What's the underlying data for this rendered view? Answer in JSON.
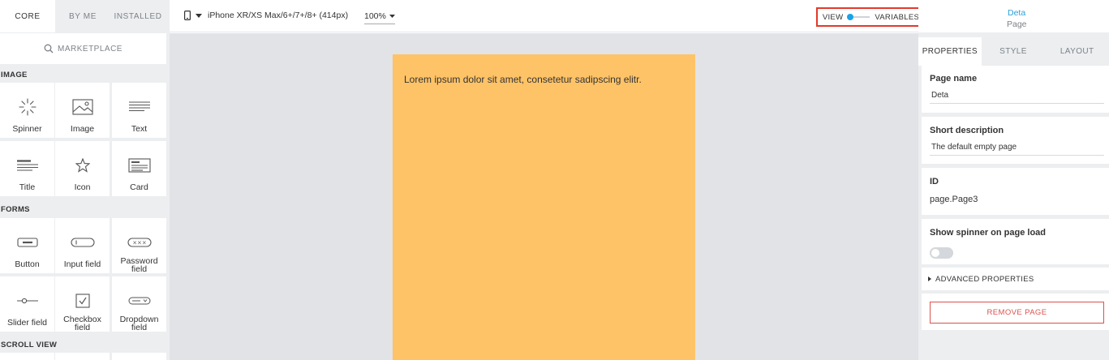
{
  "left_panel": {
    "tabs": [
      {
        "label": "CORE",
        "active": true
      },
      {
        "label": "BY ME",
        "active": false
      },
      {
        "label": "INSTALLED",
        "active": false
      }
    ],
    "marketplace_label": "MARKETPLACE",
    "sections": {
      "image": {
        "title": "IMAGE",
        "tiles": [
          {
            "label": "Spinner",
            "icon": "spinner-icon"
          },
          {
            "label": "Image",
            "icon": "image-icon"
          },
          {
            "label": "Text",
            "icon": "text-icon"
          },
          {
            "label": "Title",
            "icon": "title-icon"
          },
          {
            "label": "Icon",
            "icon": "star-icon"
          },
          {
            "label": "Card",
            "icon": "card-icon"
          }
        ]
      },
      "forms": {
        "title": "FORMS",
        "tiles": [
          {
            "label": "Button",
            "icon": "button-icon"
          },
          {
            "label": "Input field",
            "icon": "input-field-icon"
          },
          {
            "label": "Password field",
            "icon": "password-field-icon"
          },
          {
            "label": "Slider field",
            "icon": "slider-icon"
          },
          {
            "label": "Checkbox field",
            "icon": "checkbox-icon"
          },
          {
            "label": "Dropdown field",
            "icon": "dropdown-icon"
          }
        ]
      },
      "scroll_view": {
        "title": "SCROLL VIEW"
      }
    }
  },
  "toolbar": {
    "device": "iPhone XR/XS Max/6+/7+/8+ (414px)",
    "zoom": "100%",
    "view_label": "VIEW",
    "variables_label": "VARIABLES",
    "toggle_active_color": "#1aa3e8"
  },
  "canvas": {
    "page_text": "Lorem ipsum dolor sit amet, consetetur sadipscing elitr.",
    "page_background": "#fec367"
  },
  "right_header": {
    "name": "Deta",
    "type": "Page"
  },
  "right_panel": {
    "tabs": [
      {
        "label": "PROPERTIES",
        "active": true
      },
      {
        "label": "STYLE",
        "active": false
      },
      {
        "label": "LAYOUT",
        "active": false
      }
    ],
    "page_name": {
      "label": "Page name",
      "value": "Deta"
    },
    "short_description": {
      "label": "Short description",
      "value": "The default empty page"
    },
    "id": {
      "label": "ID",
      "value": "page.Page3"
    },
    "spinner": {
      "label": "Show spinner on page load",
      "enabled": false
    },
    "advanced_label": "ADVANCED PROPERTIES",
    "remove_label": "REMOVE PAGE",
    "danger_color": "#d9534f"
  }
}
